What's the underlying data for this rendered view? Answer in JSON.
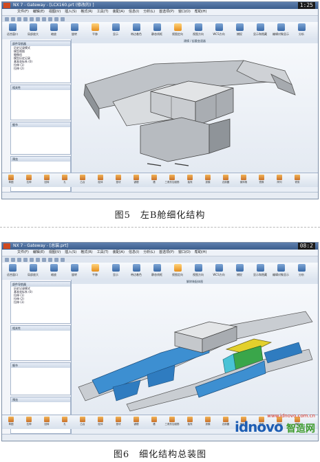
{
  "figure5": {
    "window_title": "NX 7 - Gateway - [LCX160.prt (修改的) ]",
    "clock": "1:25",
    "caption": "图5　左B舱细化结构",
    "viewport_title": "建模 / 起重变速器",
    "nav_title": "部件导航器",
    "panel2_title": "相关性",
    "panel3_title": "细节",
    "panel4_title": "预览"
  },
  "figure6": {
    "window_title": "NX 7 - Gateway - [总装.prt]",
    "clock": "08:2",
    "caption": "图6　细化结构总装图",
    "viewport_title": "解除装配体图",
    "nav_title": "部件导航器",
    "panel2_title": "相关性",
    "panel3_title": "细节",
    "panel4_title": "预览"
  },
  "menu": [
    "文件(F)",
    "编辑(E)",
    "视图(V)",
    "插入(S)",
    "格式(R)",
    "工具(T)",
    "装配(A)",
    "信息(I)",
    "分析(L)",
    "首选项(P)",
    "窗口(O)",
    "帮助(H)"
  ],
  "ribbon": [
    "适合窗口",
    "局部放大",
    "缩放",
    "旋转",
    "平移",
    "显示",
    "带边着色",
    "静态线框",
    "视图定向",
    "视图方向",
    "WCS方向",
    "捕捉",
    "显示和隐藏",
    "编辑对象显示",
    "分析",
    "坐标系",
    "图层",
    "全屏"
  ],
  "bottom_tools": [
    "草图",
    "拉伸",
    "回转",
    "孔",
    "凸台",
    "腔体",
    "垫块",
    "键槽",
    "槽",
    "三角形加强筋",
    "抽壳",
    "拔模",
    "边倒圆",
    "倒斜角",
    "镜像",
    "阵列",
    "修剪",
    "缝合",
    "同步建模",
    "特征编辑"
  ],
  "tree_lines": [
    "历史记录模式",
    "模型视图",
    "摄像机",
    "模型历史记录",
    "基准坐标系 (0)",
    "拉伸 (1)",
    "拉伸 (2)",
    "拉伸 (3)"
  ],
  "watermark": {
    "small": "www.idnovo.com.cn",
    "big": "idnovo",
    "cn": "智造网"
  }
}
